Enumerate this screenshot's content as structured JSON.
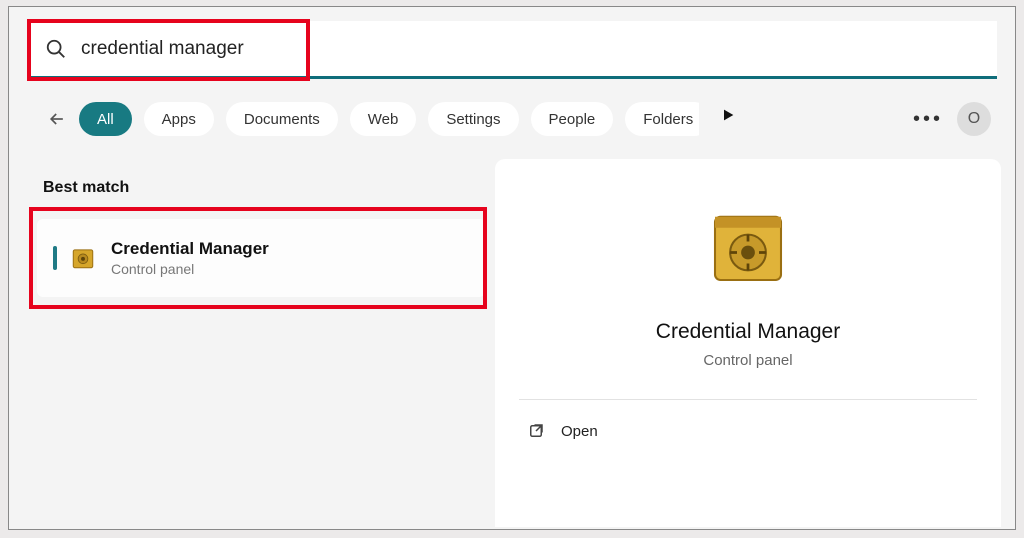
{
  "search": {
    "value": "credential manager"
  },
  "filters": {
    "items": [
      {
        "label": "All",
        "active": true
      },
      {
        "label": "Apps",
        "active": false
      },
      {
        "label": "Documents",
        "active": false
      },
      {
        "label": "Web",
        "active": false
      },
      {
        "label": "Settings",
        "active": false
      },
      {
        "label": "People",
        "active": false
      },
      {
        "label": "Folders",
        "active": false
      }
    ]
  },
  "avatar_initial": "O",
  "best_match_label": "Best match",
  "result": {
    "title": "Credential Manager",
    "subtitle": "Control panel"
  },
  "preview": {
    "title": "Credential Manager",
    "subtitle": "Control panel",
    "open_label": "Open"
  }
}
